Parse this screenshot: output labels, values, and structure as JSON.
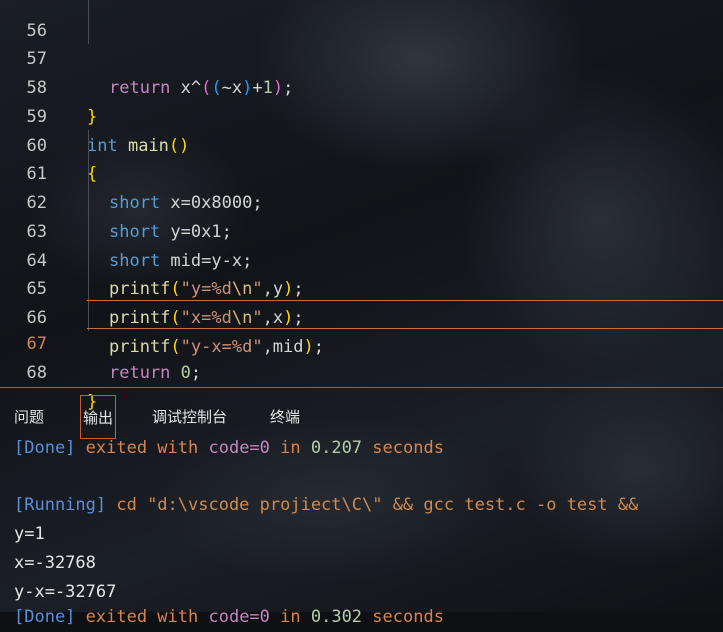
{
  "editor": {
    "line_numbers": [
      "56",
      "57",
      "58",
      "59",
      "60",
      "61",
      "62",
      "63",
      "64",
      "65",
      "66",
      "67",
      "68"
    ],
    "active_line": "67",
    "code": {
      "l57": {
        "kw": "return",
        "rest": " x^",
        "p1": "(",
        "p2": "(",
        "tilde": "~x",
        "p2c": ")",
        "plus": "+",
        "one": "1",
        "p1c": ")",
        "semi": ";"
      },
      "l58": {
        "brace": "}"
      },
      "l59": {
        "kw": "int",
        "sp": " ",
        "fn": "main",
        "open": "(",
        "close": ")"
      },
      "l60": {
        "brace": "{"
      },
      "l61": {
        "kw": "short",
        "rest": " x=",
        "num": "0x8000",
        "semi": ";"
      },
      "l62": {
        "kw": "short",
        "rest": " y=",
        "num": "0x1",
        "semi": ";"
      },
      "l63": {
        "kw": "short",
        "rest": " mid=y-x;"
      },
      "l64": {
        "fn": "printf",
        "open": "(",
        "str1": "\"y=%d",
        "esc": "\\n",
        "str2": "\"",
        "rest": ",y",
        "close": ")",
        "semi": ";"
      },
      "l65": {
        "fn": "printf",
        "open": "(",
        "str1": "\"x=%d",
        "esc": "\\n",
        "str2": "\"",
        "rest": ",x",
        "close": ")",
        "semi": ";"
      },
      "l66": {
        "fn": "printf",
        "open": "(",
        "str1": "\"y-x=%d\"",
        "rest": ",mid",
        "close": ")",
        "semi": ";"
      },
      "l67": {
        "kw": "return",
        "sp": " ",
        "num": "0",
        "semi": ";"
      },
      "l68": {
        "brace": "}"
      }
    }
  },
  "panel": {
    "tabs": [
      "问题",
      "输出",
      "调试控制台",
      "终端"
    ],
    "active_tab": "输出",
    "output": {
      "done_tag": "[Done]",
      "done_exit": " exited with ",
      "done_code": "code=0",
      "done_in": " in ",
      "done_secs": "0.207",
      "done_tail": " seconds",
      "running_tag": "[Running]",
      "running_cmd": " cd \"d:\\vscode projiect\\C\\\" && gcc test.c -o test && ",
      "lines": [
        "y=1",
        "x=-32768",
        "y-x=-32767"
      ],
      "done2_tag": "[Done]",
      "done2_exit": " exited with ",
      "done2_code": "code=0",
      "done2_in": " in ",
      "done2_secs": "0.302",
      "done2_tail": " seconds"
    }
  }
}
